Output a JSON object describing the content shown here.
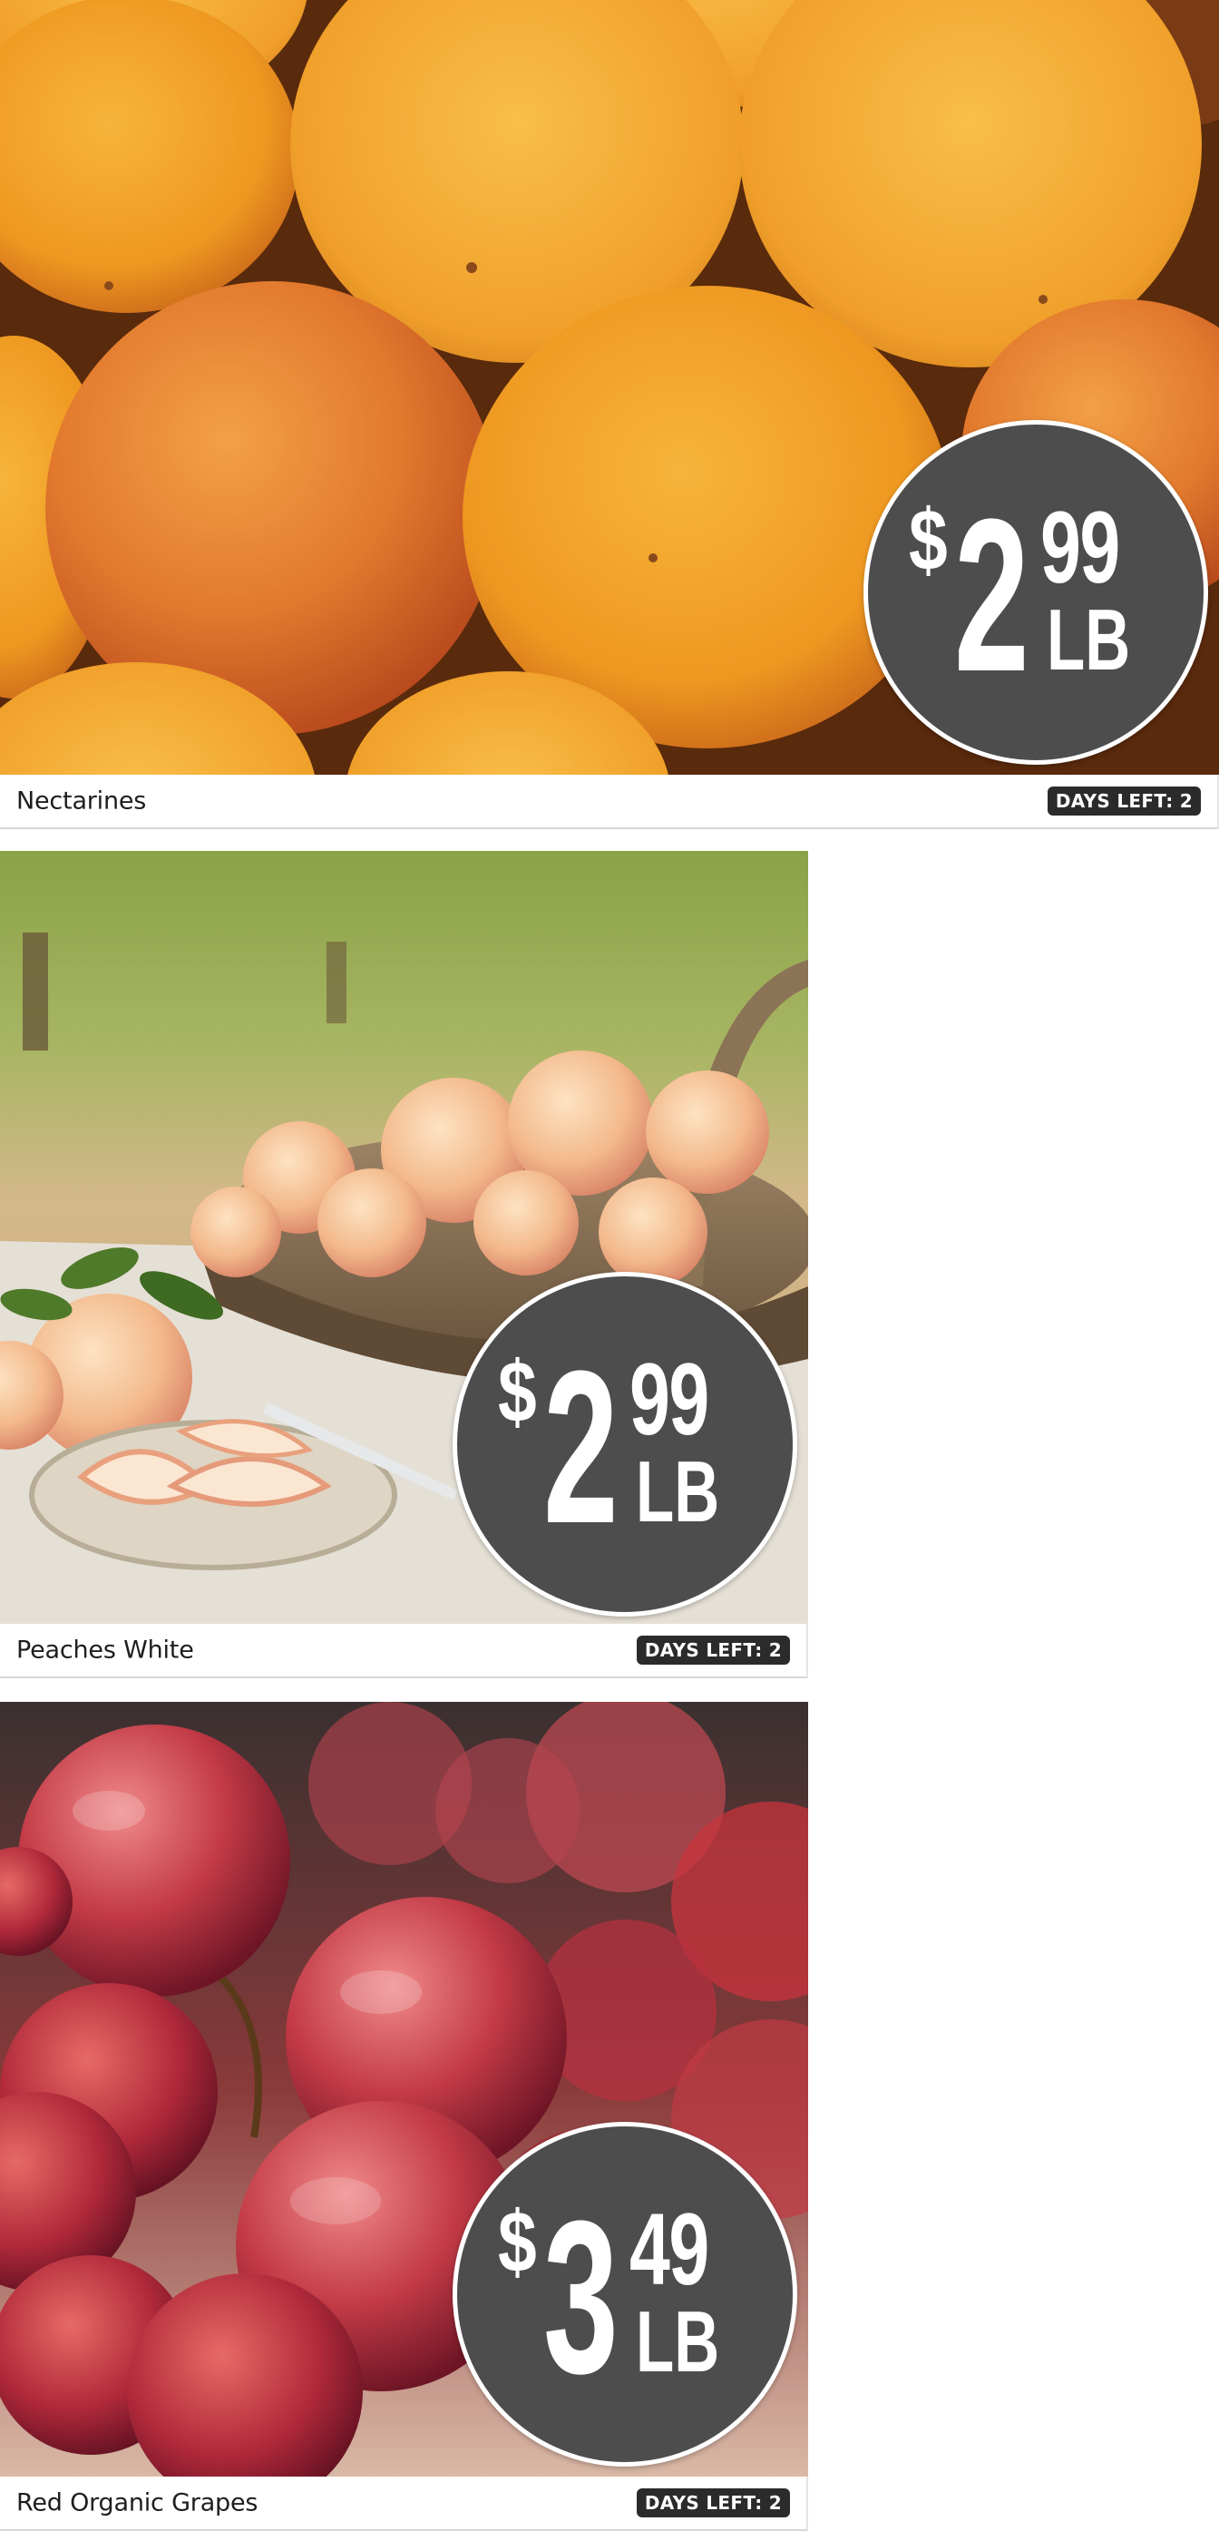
{
  "products": [
    {
      "name": "Nectarines",
      "days_left": "DAYS LEFT: 2",
      "price": {
        "currency": "$",
        "dollars": "2",
        "cents": "99",
        "unit": "LB"
      },
      "image": "nectarines-photo"
    },
    {
      "name": "Peaches White",
      "days_left": "DAYS LEFT: 2",
      "price": {
        "currency": "$",
        "dollars": "2",
        "cents": "99",
        "unit": "LB"
      },
      "image": "white-peaches-photo"
    },
    {
      "name": "Red Organic Grapes",
      "days_left": "DAYS LEFT: 2",
      "price": {
        "currency": "$",
        "dollars": "3",
        "cents": "49",
        "unit": "LB"
      },
      "image": "red-grapes-photo"
    }
  ],
  "colors": {
    "price_badge": "#4d4d4d",
    "days_badge": "#2b2b2b",
    "text": "#1e1e1e"
  }
}
